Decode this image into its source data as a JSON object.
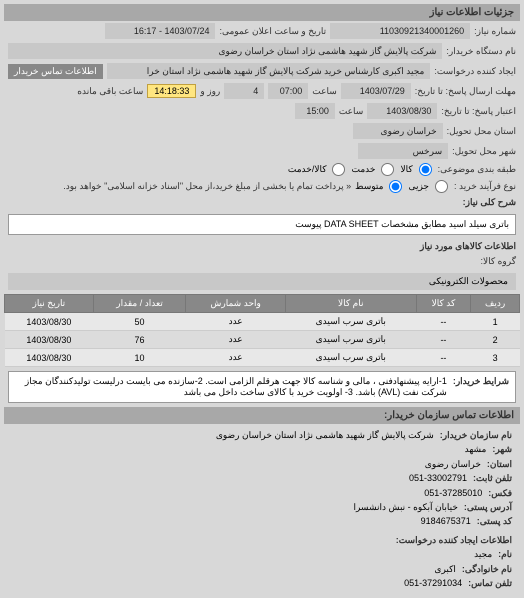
{
  "header": {
    "title": "جزئیات اطلاعات نیاز"
  },
  "fields": {
    "need_number_label": "شماره نیاز:",
    "need_number": "11030921340001260",
    "announce_label": "تاریخ و ساعت اعلان عمومی:",
    "announce_value": "1403/07/24 - 16:17",
    "buyer_org_label": "نام دستگاه خریدار:",
    "buyer_org": "شرکت پالایش گاز شهید هاشمی نژاد   استان خراسان رضوی",
    "requester_label": "ایجاد کننده درخواست:",
    "requester": "مجید اکبری کارشناس خرید شرکت پالایش گاز شهید هاشمی نژاد   استان خرا",
    "contact_btn": "اطلاعات تماس خریدار",
    "deadline_label": "مهلت ارسال پاسخ: تا تاریخ:",
    "deadline_date": "1403/07/29",
    "time_label": "ساعت",
    "deadline_time": "07:00",
    "days_remain": "4",
    "days_remain_label": "روز و",
    "time_remain": "14:18:33",
    "time_remain_label": "ساعت باقی مانده",
    "validity_label": "اعتبار پاسخ: تا تاریخ:",
    "validity_date": "1403/08/30",
    "validity_time": "15:00",
    "delivery_province_label": "استان محل تحویل:",
    "delivery_province": "خراسان رضوی",
    "delivery_city_label": "شهر محل تحویل:",
    "delivery_city": "سرخس",
    "category_label": "طبقه بندی موضوعی:",
    "cat_goods": "کالا",
    "cat_service": "خدمت",
    "cat_goods_service": "کالا/خدمت",
    "process_label": "نوع فرآیند خرید :",
    "proc_small": "جزیی",
    "proc_medium": "متوسط",
    "proc_note": "« پرداخت تمام یا بخشی از مبلغ خرید،از محل \"اسناد خزانه اسلامی\" خواهد بود.",
    "desc_label": "شرح کلی نیاز:",
    "desc_text": "باتری سیلد اسید مطابق مشخصات DATA SHEET پیوست",
    "goods_header": "اطلاعات کالاهای مورد نیاز",
    "goods_group_label": "گروه کالا:",
    "goods_group": "محصولات الکترونیکی",
    "conditions_label": "شرایط خریدار:",
    "conditions_text": "1-ارایه پیشنهادفنی ، مالی و شناسه کالا جهت هرقلم الزامی است. 2-سازنده می بایست درلیست تولیدکنندگان مجاز شرکت نفت (AVL) باشد. 3- اولویت خرید با کالای ساخت داخل می باشد",
    "contact_header": "اطلاعات تماس سازمان خریدار:",
    "c_org_label": "نام سازمان خریدار:",
    "c_org": "شرکت پالایش گاز شهید هاشمی نژاد استان خراسان رضوی",
    "c_city_label": "شهر:",
    "c_city": "مشهد",
    "c_province_label": "استان:",
    "c_province": "خراسان رضوی",
    "c_phone_label": "تلفن ثابت:",
    "c_phone": "051-33002791",
    "c_fax_label": "فکس:",
    "c_fax": "051-37285010",
    "c_address_label": "آدرس پستی:",
    "c_address": "خیابان آبکوه - نبش دانشسرا",
    "c_postal_label": "کد پستی:",
    "c_postal": "9184675371",
    "creator_header": "اطلاعات ایجاد کننده درخواست:",
    "cr_name_label": "نام:",
    "cr_name": "مجید",
    "cr_family_label": "نام خانوادگی:",
    "cr_family": "اکبری",
    "cr_phone_label": "تلفن تماس:",
    "cr_phone": "051-37291034"
  },
  "table": {
    "headers": {
      "row": "ردیف",
      "code": "کد کالا",
      "name": "نام کالا",
      "unit": "واحد شمارش",
      "qty": "تعداد / مقدار",
      "date": "تاریخ نیاز"
    },
    "rows": [
      {
        "row": "1",
        "code": "--",
        "name": "باتری سرب اسیدی",
        "unit": "عدد",
        "qty": "50",
        "date": "1403/08/30"
      },
      {
        "row": "2",
        "code": "--",
        "name": "باتری سرب اسیدی",
        "unit": "عدد",
        "qty": "76",
        "date": "1403/08/30"
      },
      {
        "row": "3",
        "code": "--",
        "name": "باتری سرب اسیدی",
        "unit": "عدد",
        "qty": "10",
        "date": "1403/08/30"
      }
    ]
  }
}
